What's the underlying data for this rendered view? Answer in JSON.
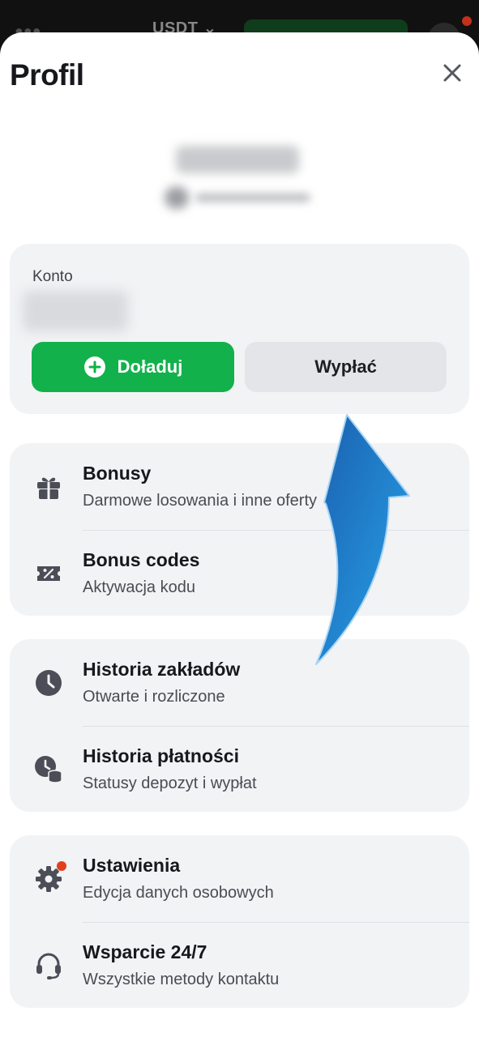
{
  "background_app": {
    "currency": "USDT"
  },
  "profile": {
    "title": "Profil",
    "close_icon": "close-icon"
  },
  "account": {
    "label": "Konto",
    "deposit_label": "Doładuj",
    "withdraw_label": "Wypłać"
  },
  "menu_groups": [
    {
      "items": [
        {
          "title": "Bonusy",
          "subtitle": "Darmowe losowania i inne oferty",
          "icon": "gift-icon"
        },
        {
          "title": "Bonus codes",
          "subtitle": "Aktywacja kodu",
          "icon": "ticket-percent-icon"
        }
      ]
    },
    {
      "items": [
        {
          "title": "Historia zakładów",
          "subtitle": "Otwarte i rozliczone",
          "icon": "clock-icon"
        },
        {
          "title": "Historia płatności",
          "subtitle": "Statusy depozyt i wypłat",
          "icon": "clock-coins-icon"
        }
      ]
    },
    {
      "items": [
        {
          "title": "Ustawienia",
          "subtitle": "Edycja danych osobowych",
          "icon": "gear-icon"
        },
        {
          "title": "Wsparcie 24/7",
          "subtitle": "Wszystkie metody kontaktu",
          "icon": "headset-icon"
        }
      ]
    }
  ],
  "colors": {
    "deposit_green": "#12b14b",
    "card_bg": "#f2f3f5",
    "icon_gray": "#4b4e57",
    "notification_red": "#e2401d",
    "arrow_blue": "#1f86d6"
  }
}
